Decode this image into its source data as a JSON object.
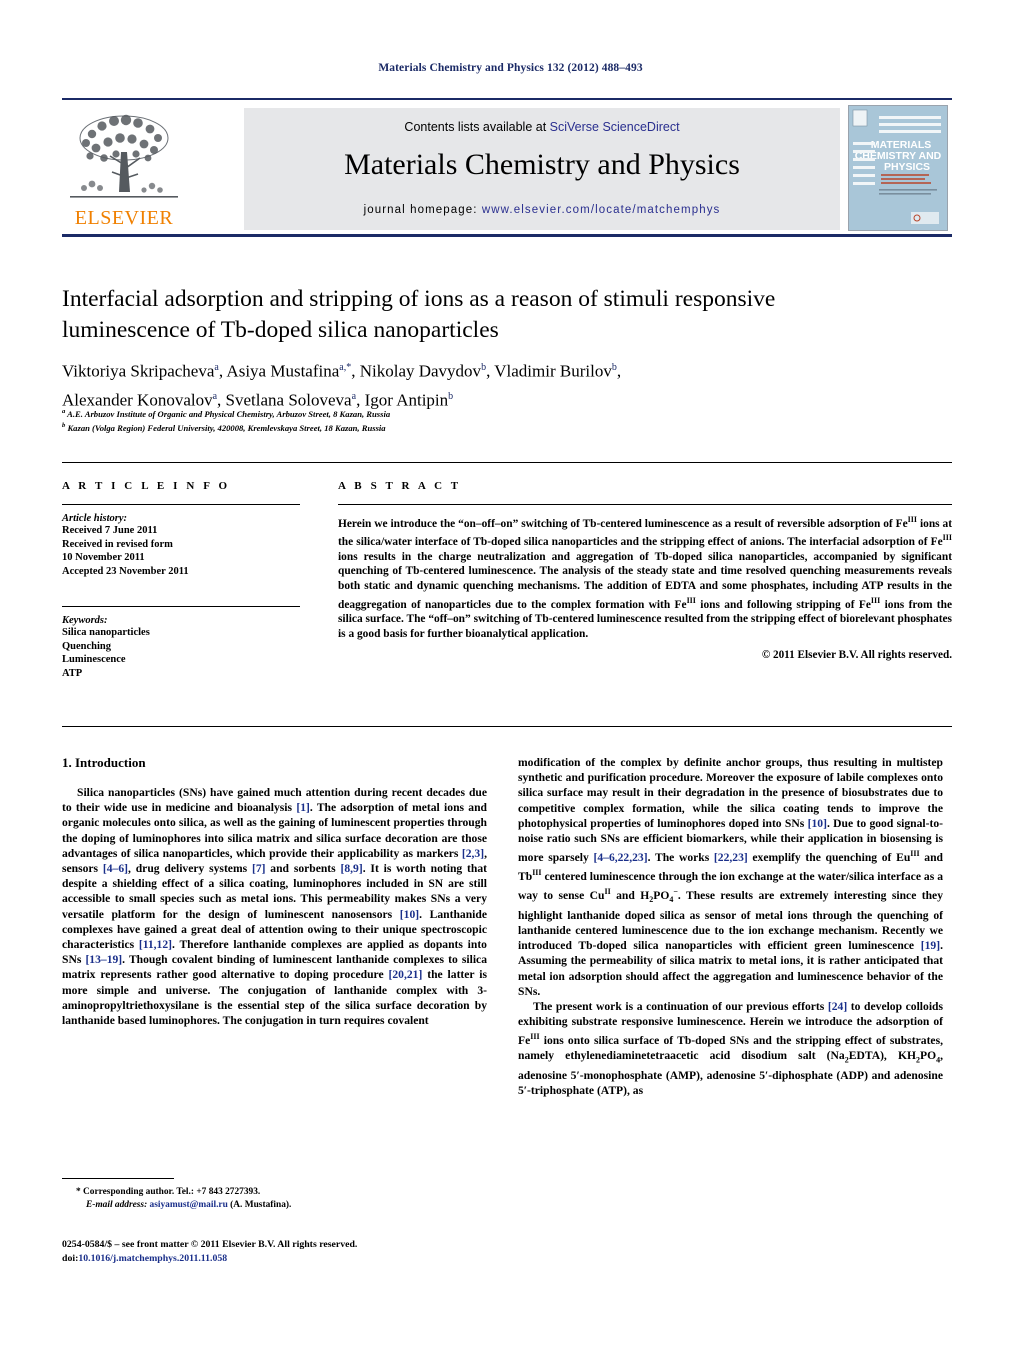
{
  "running_head": "Materials Chemistry and Physics 132 (2012) 488–493",
  "masthead": {
    "publisher_word": "ELSEVIER",
    "contents_prefix": "Contents lists available at ",
    "contents_link": "SciVerse ScienceDirect",
    "journal_title": "Materials Chemistry and Physics",
    "homepage_prefix": "journal homepage: ",
    "homepage_url": "www.elsevier.com/locate/matchemphys",
    "cover": {
      "line1": "MATERIALS",
      "line2": "CHEMISTRY AND",
      "line3": "PHYSICS"
    },
    "rule_color": "#1b2a66",
    "panel_color": "#e6e7e9",
    "link_color": "#2a2f8f",
    "elsevier_orange": "#f08000"
  },
  "article": {
    "title": "Interfacial adsorption and stripping of ions as a reason of stimuli responsive luminescence of Tb-doped silica nanoparticles",
    "affiliation_a": "A.E. Arbuzov Institute of Organic and Physical Chemistry, Arbuzov Street, 8 Kazan, Russia",
    "affiliation_b": "Kazan (Volga Region) Federal University, 420008, Kremlevskaya Street, 18 Kazan, Russia"
  },
  "article_info": {
    "heading": "A R T I C L E    I N F O",
    "history_label": "Article history:",
    "history": [
      "Received 7 June 2011",
      "Received in revised form",
      "10 November 2011",
      "Accepted 23 November 2011"
    ],
    "keywords_label": "Keywords:",
    "keywords": [
      "Silica nanoparticles",
      "Quenching",
      "Luminescence",
      "ATP"
    ]
  },
  "abstract": {
    "heading": "A B S T R A C T",
    "copyright": "© 2011 Elsevier B.V. All rights reserved."
  },
  "introduction": {
    "heading": "1.  Introduction"
  },
  "footnotes": {
    "corresponding_label": "* Corresponding author. Tel.: +7 843 2727393.",
    "email_label": "E-mail address:",
    "email": "asiyamust@mail.ru",
    "email_attrib": "(A. Mustafina).",
    "issn_line": "0254-0584/$ – see front matter © 2011 Elsevier B.V. All rights reserved.",
    "doi_label": "doi:",
    "doi": "10.1016/j.matchemphys.2011.11.058"
  }
}
